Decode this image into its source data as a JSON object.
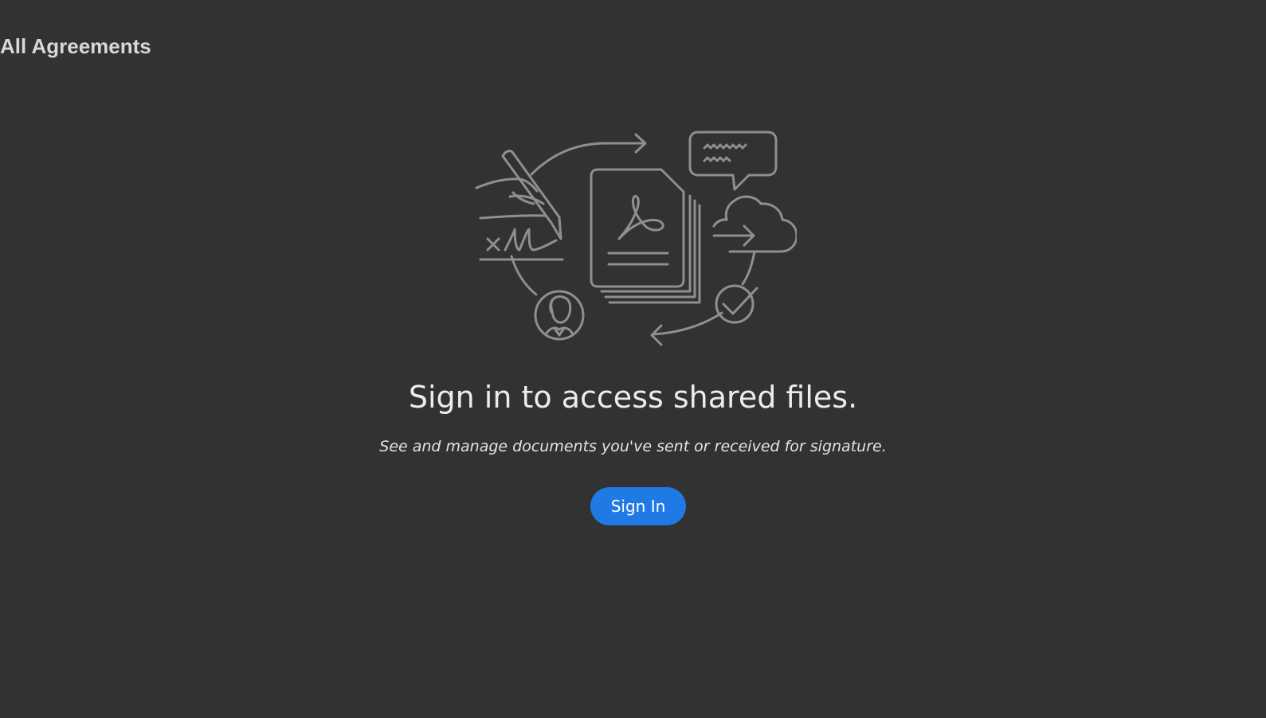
{
  "header": {
    "title": "All Agreements"
  },
  "empty_state": {
    "illustration": "agreements-cycle-illustration",
    "headline": "Sign in to access shared files.",
    "description": "See and manage documents you've sent or received for signature.",
    "sign_in_label": "Sign In"
  },
  "colors": {
    "background": "#323232",
    "illustration_stroke": "#8f8f8f",
    "accent": "#1f7ae6",
    "text": "#ececec"
  }
}
